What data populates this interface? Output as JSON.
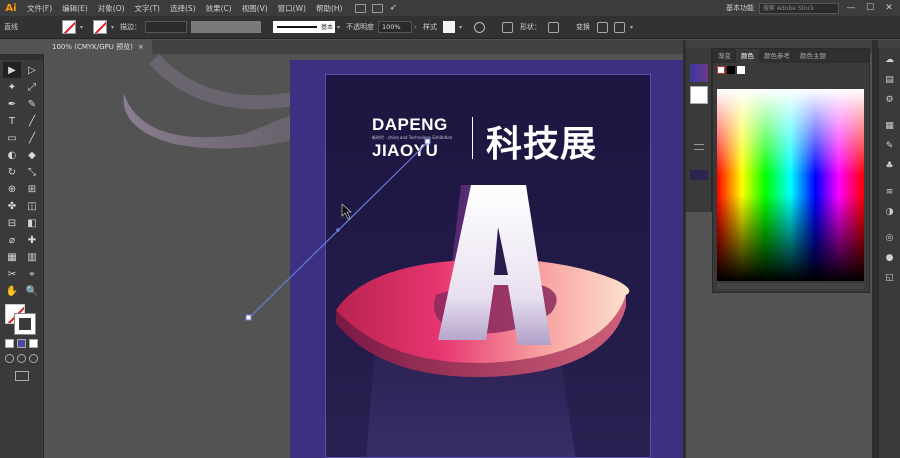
{
  "app": {
    "logo": "Ai",
    "workspace": "基本功能",
    "search_placeholder": "搜索 Adobe Stock"
  },
  "menu": [
    "文件(F)",
    "编辑(E)",
    "对象(O)",
    "文字(T)",
    "选择(S)",
    "效果(C)",
    "视图(V)",
    "窗口(W)",
    "帮助(H)"
  ],
  "window_controls": [
    "—",
    "☐",
    "✕"
  ],
  "control_bar": {
    "selection_label": "直线",
    "stroke_label": "描边：",
    "stroke_style": "基本",
    "opacity_label": "不透明度",
    "opacity_value": "100%",
    "style_label": "样式",
    "shape_label": "形状：",
    "transform_label": "变换"
  },
  "document_tab": {
    "title": "100% (CMYK/GPU 预览)",
    "close": "×"
  },
  "tools": [
    "▶",
    "▷",
    "✦",
    "⤢",
    "✒",
    "✎",
    "T",
    "╱",
    "▭",
    "╱",
    "◐",
    "◆",
    "↻",
    "⤡",
    "⊕",
    "⊞",
    "✤",
    "◫",
    "⊟",
    "◧",
    "⌀",
    "✚",
    "▦",
    "▥",
    "✂",
    "⌖",
    "✋",
    "🔍"
  ],
  "artwork": {
    "brand_line1": "DAPENG",
    "brand_sub": "新时代 · china and Technology Exhibition",
    "brand_line2": "JIAOYU",
    "title_cn": "科技展",
    "letter": "A"
  },
  "color_panel": {
    "tabs": [
      "渐变",
      "颜色",
      "颜色参考",
      "颜色主题"
    ],
    "active_tab": "颜色"
  },
  "colors": {
    "artboard_bg": "#3d2f82",
    "artboard": "#1e1640",
    "accent_pink": "#e6356f",
    "guide_line": "#6a7bd8"
  }
}
